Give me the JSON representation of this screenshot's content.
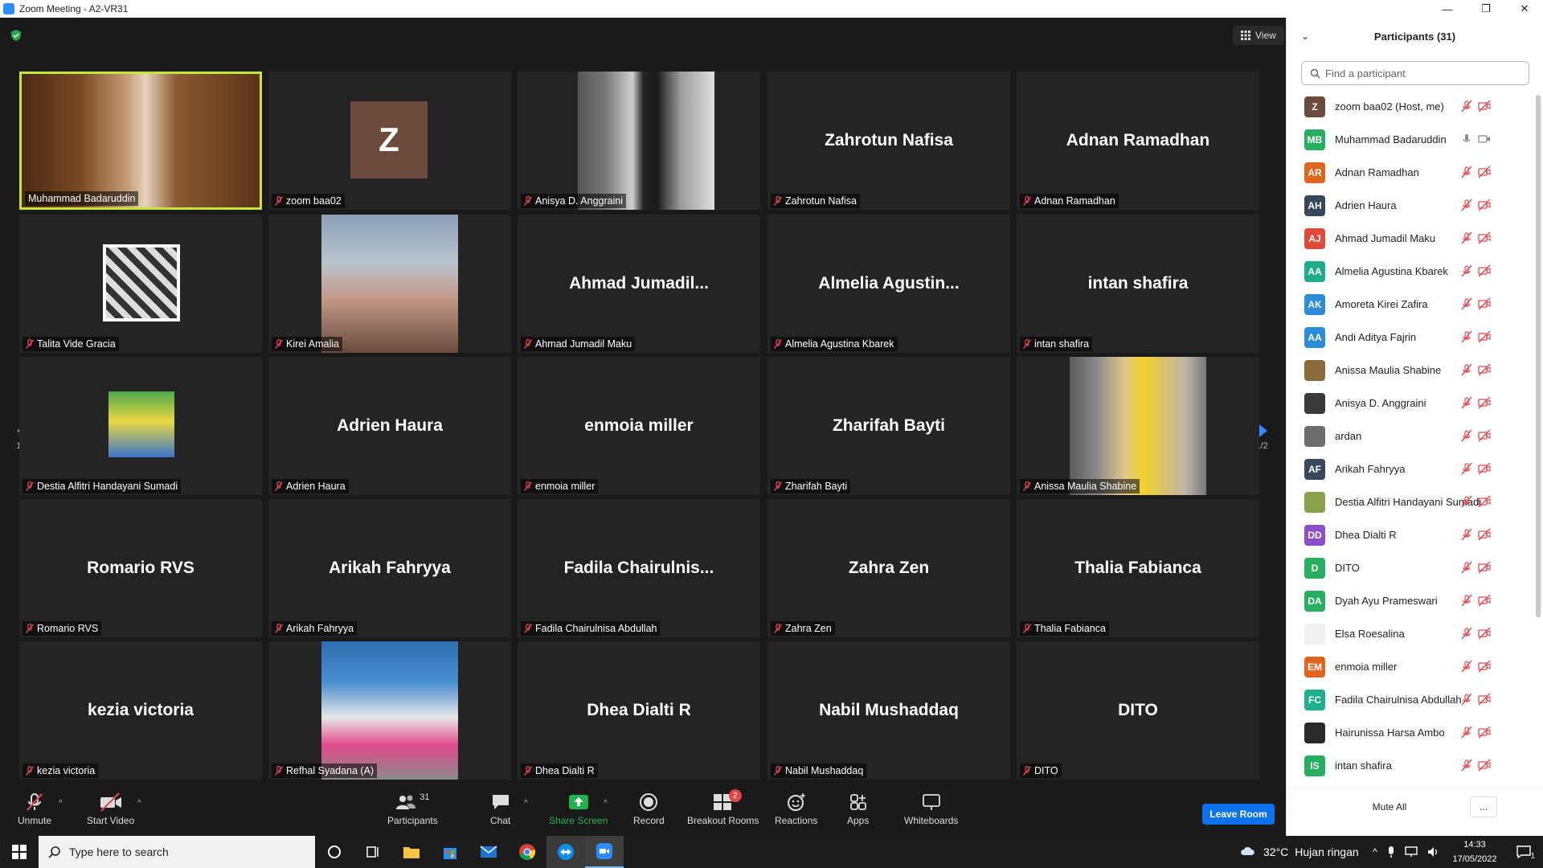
{
  "window": {
    "title": "Zoom Meeting - A2-VR31",
    "minimize": "—",
    "restore": "❐",
    "close": "✕"
  },
  "view_label": "View",
  "pagination": {
    "left": "1/2",
    "right": "1/2"
  },
  "tiles": [
    {
      "caption": "Muhammad Badaruddin",
      "center": "",
      "kind": "video-host",
      "muted": false
    },
    {
      "caption": "zoom baa02",
      "center": "",
      "avatar": "Z",
      "kind": "avatar",
      "muted": true
    },
    {
      "caption": "Anisya D. Anggraini",
      "center": "",
      "kind": "photo",
      "muted": true
    },
    {
      "caption": "Zahrotun Nafisa",
      "center": "Zahrotun Nafisa",
      "kind": "name",
      "muted": true
    },
    {
      "caption": "Adnan Ramadhan",
      "center": "Adnan Ramadhan",
      "kind": "name",
      "muted": true
    },
    {
      "caption": "Talita Vide Gracia",
      "center": "",
      "kind": "photo",
      "muted": true
    },
    {
      "caption": "Kirei Amalia",
      "center": "",
      "kind": "photo",
      "muted": true
    },
    {
      "caption": "Ahmad Jumadil Maku",
      "center": "Ahmad  Jumadil...",
      "kind": "name",
      "muted": true
    },
    {
      "caption": "Almelia Agustina Kbarek",
      "center": "Almelia  Agustin...",
      "kind": "name",
      "muted": true
    },
    {
      "caption": "intan shafira",
      "center": "intan shafira",
      "kind": "name",
      "muted": true
    },
    {
      "caption": "Destia Alfitri Handayani Sumadi",
      "center": "",
      "kind": "photo",
      "muted": true
    },
    {
      "caption": "Adrien Haura",
      "center": "Adrien Haura",
      "kind": "name",
      "muted": true
    },
    {
      "caption": "enmoia miller",
      "center": "enmoia miller",
      "kind": "name",
      "muted": true
    },
    {
      "caption": "Zharifah Bayti",
      "center": "Zharifah Bayti",
      "kind": "name",
      "muted": true
    },
    {
      "caption": "Anissa Maulia Shabine",
      "center": "",
      "kind": "photo",
      "muted": true
    },
    {
      "caption": "Romario RVS",
      "center": "Romario RVS",
      "kind": "name",
      "muted": true
    },
    {
      "caption": "Arikah Fahryya",
      "center": "Arikah Fahryya",
      "kind": "name",
      "muted": true
    },
    {
      "caption": "Fadila Chairulnisa Abdullah",
      "center": "Fadila  Chairulnis...",
      "kind": "name",
      "muted": true
    },
    {
      "caption": "Zahra Zen",
      "center": "Zahra Zen",
      "kind": "name",
      "muted": true
    },
    {
      "caption": "Thalia Fabianca",
      "center": "Thalia Fabianca",
      "kind": "name",
      "muted": true
    },
    {
      "caption": "kezia victoria",
      "center": "kezia victoria",
      "kind": "name",
      "muted": true
    },
    {
      "caption": "Refhal Syadana (A)",
      "center": "",
      "kind": "photo",
      "muted": true
    },
    {
      "caption": "Dhea Dialti R",
      "center": "Dhea Dialti R",
      "kind": "name",
      "muted": true
    },
    {
      "caption": "Nabil Mushaddaq",
      "center": "Nabil Mushaddaq",
      "kind": "name",
      "muted": true
    },
    {
      "caption": "DITO",
      "center": "DITO",
      "kind": "name",
      "muted": true
    }
  ],
  "toolbar": {
    "unmute": "Unmute",
    "start_video": "Start Video",
    "participants": "Participants",
    "participants_count": "31",
    "chat": "Chat",
    "share_screen": "Share Screen",
    "record": "Record",
    "breakout_rooms": "Breakout Rooms",
    "breakout_badge": "2",
    "reactions": "Reactions",
    "apps": "Apps",
    "whiteboards": "Whiteboards",
    "leave": "Leave Room"
  },
  "panel": {
    "title": "Participants (31)",
    "search_placeholder": "Find a participant",
    "mute_all": "Mute All",
    "more": "...",
    "participants": [
      {
        "initials": "Z",
        "name": "zoom baa02 (Host, me)",
        "color": "#6c4a3c",
        "kind": "initials"
      },
      {
        "initials": "MB",
        "name": "Muhammad Badaruddin",
        "color": "#27ae60",
        "kind": "initials",
        "live": true
      },
      {
        "initials": "AR",
        "name": "Adnan Ramadhan",
        "color": "#e0651f",
        "kind": "initials"
      },
      {
        "initials": "AH",
        "name": "Adrien Haura",
        "color": "#35485e",
        "kind": "initials"
      },
      {
        "initials": "AJ",
        "name": "Ahmad Jumadil Maku",
        "color": "#e04a3c",
        "kind": "initials"
      },
      {
        "initials": "AA",
        "name": "Almelia Agustina Kbarek",
        "color": "#1fae8c",
        "kind": "initials"
      },
      {
        "initials": "AK",
        "name": "Amoreta Kirei Zafira",
        "color": "#2d8cd8",
        "kind": "initials"
      },
      {
        "initials": "AA",
        "name": "Andi Aditya Fajrin",
        "color": "#2d8cd8",
        "kind": "initials"
      },
      {
        "initials": "",
        "name": "Anissa Maulia Shabine",
        "color": "#8a6a3a",
        "kind": "photo"
      },
      {
        "initials": "",
        "name": "Anisya D. Anggraini",
        "color": "#3a3a3a",
        "kind": "photo"
      },
      {
        "initials": "",
        "name": "ardan",
        "color": "#6d6d6d",
        "kind": "photo"
      },
      {
        "initials": "AF",
        "name": "Arikah Fahryya",
        "color": "#35485e",
        "kind": "initials"
      },
      {
        "initials": "",
        "name": "Destia Alfitri Handayani Sumadi",
        "color": "#8aa04a",
        "kind": "photo"
      },
      {
        "initials": "DD",
        "name": "Dhea Dialti R",
        "color": "#8b4fc9",
        "kind": "initials"
      },
      {
        "initials": "D",
        "name": "DITO",
        "color": "#27ae60",
        "kind": "initials"
      },
      {
        "initials": "DA",
        "name": "Dyah Ayu Prameswari",
        "color": "#27ae60",
        "kind": "initials"
      },
      {
        "initials": "",
        "name": "Elsa Roesalina",
        "color": "#f0f0f0",
        "kind": "photo"
      },
      {
        "initials": "EM",
        "name": "enmoia miller",
        "color": "#e0651f",
        "kind": "initials"
      },
      {
        "initials": "FC",
        "name": "Fadila Chairulnisa Abdullah",
        "color": "#1fae8c",
        "kind": "initials"
      },
      {
        "initials": "",
        "name": "Hairunissa Harsa Ambo",
        "color": "#2a2a2a",
        "kind": "photo"
      },
      {
        "initials": "IS",
        "name": "intan shafira",
        "color": "#27ae60",
        "kind": "initials"
      }
    ]
  },
  "taskbar": {
    "search_placeholder": "Type here to search",
    "weather_temp": "32°C",
    "weather_desc": "Hujan ringan",
    "time": "14:33",
    "date": "17/05/2022",
    "notifications": "1"
  },
  "colors": {
    "active_speaker": "#c6e53d",
    "leave_button": "#0e72ed",
    "muted_red": "#e0464e",
    "share_green": "#22b14c"
  }
}
